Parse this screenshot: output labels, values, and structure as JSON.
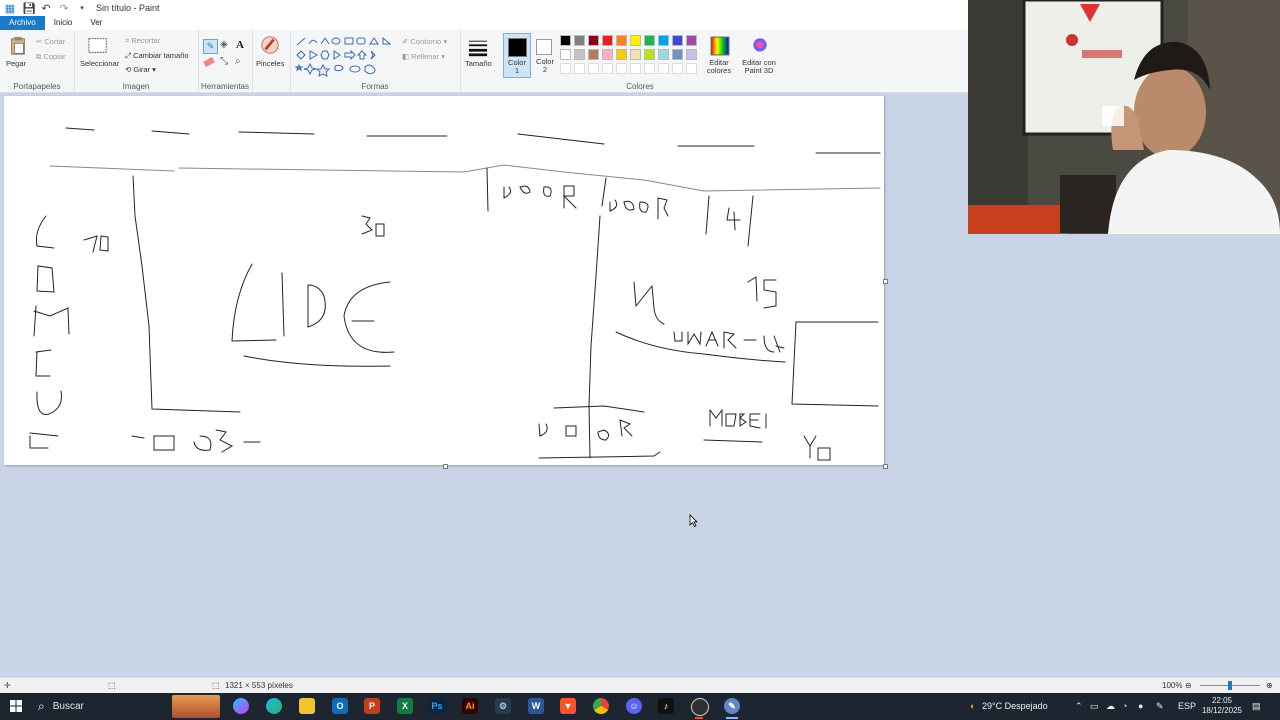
{
  "window": {
    "title": "Sin título - Paint",
    "quick_access": [
      "save-icon",
      "undo-icon",
      "redo-icon"
    ]
  },
  "menu": {
    "file": "Archivo",
    "home": "Inicio",
    "view": "Ver"
  },
  "ribbon": {
    "clipboard": {
      "paste": "Pegar",
      "cut": "Cortar",
      "copy": "Copiar",
      "group": "Portapapeles"
    },
    "image": {
      "select": "Seleccionar",
      "crop": "Recortar",
      "resize": "Cambiar tamaño",
      "rotate": "Girar",
      "group": "Imagen"
    },
    "tools": {
      "group": "Herramientas",
      "text_tool": "A"
    },
    "brushes": {
      "label": "Pinceles"
    },
    "shapes": {
      "outline": "Contorno",
      "fill": "Rellenar",
      "group": "Formas"
    },
    "size": {
      "label": "Tamaño"
    },
    "color1": {
      "label": "Color 1",
      "value": "#000000"
    },
    "color2": {
      "label": "Color 2",
      "value": "#ffffff"
    },
    "colors": {
      "group": "Colores",
      "palette_row1": [
        "#000000",
        "#7f7f7f",
        "#880015",
        "#ed1c24",
        "#ff7f27",
        "#fff200",
        "#22b14c",
        "#00a2e8",
        "#3f48cc",
        "#a349a4"
      ],
      "palette_row2": [
        "#ffffff",
        "#c3c3c3",
        "#b97a57",
        "#ffaec9",
        "#ffc90e",
        "#efe4b0",
        "#b5e61d",
        "#99d9ea",
        "#7092be",
        "#c8bfe7"
      ],
      "edit": "Editar colores",
      "paint3d": "Editar con Paint 3D"
    }
  },
  "canvas": {
    "drawing": [
      "DOOR",
      "DOOR",
      "LIDE",
      "DOOR",
      "MOBEL",
      "YO",
      "NUMARCA",
      "35",
      "70",
      "30",
      "15"
    ]
  },
  "status": {
    "dimensions": "1321 × 553 píxeles",
    "zoom": "100%"
  },
  "taskbar": {
    "search": "Buscar",
    "weather": "29°C  Despejado",
    "language": "ESP",
    "time": "22:05",
    "date": "18/12/2025",
    "apps": [
      "copilot",
      "edge",
      "explorer",
      "outlook",
      "powerpoint",
      "excel",
      "photoshop",
      "illustrator",
      "settings",
      "word",
      "brave",
      "chrome",
      "discord",
      "tiktok",
      "obs",
      "paint"
    ]
  }
}
